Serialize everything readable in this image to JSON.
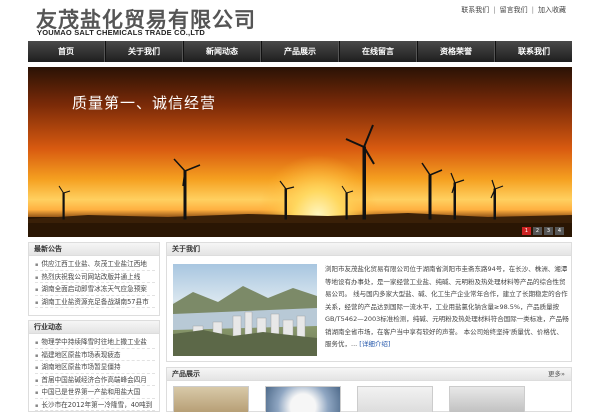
{
  "header": {
    "logo_cn": "友茂盐化贸易有限公司",
    "logo_en": "YOUMAO SALT CHEMICALS TRADE CO.,LTD",
    "links": [
      "联系我们",
      "留言我们",
      "加入收藏"
    ]
  },
  "nav": {
    "items": [
      "首页",
      "关于我们",
      "新闻动态",
      "产品展示",
      "在线留言",
      "资格荣誉",
      "联系我们"
    ]
  },
  "banner": {
    "title": "质量第一、诚信经营",
    "dots": [
      "1",
      "2",
      "3",
      "4"
    ],
    "active_dot": 0
  },
  "latest": {
    "title": "最新公告",
    "items": [
      "供应江西工业盐、灰茂工业盐江西地",
      "热烈庆祝我公司网站改版并通上线",
      "湖南全面启动即雪冰冻天气应急预案",
      "湖南工业盐资源充足备战湖南57县市"
    ]
  },
  "industry": {
    "title": "行业动态",
    "items": [
      "物理学中持续降雪时往地上撒工业盐",
      "福建地区原盐市场表现疲态",
      "湖南地区原盐市场暂显僵持",
      "首届中国盐碱经济合作高端峰会四月",
      "中国已是世界第一产盐和用盐大国",
      "长沙市在2012年第一冷隆雪，40吨到"
    ]
  },
  "about": {
    "title": "关于我们",
    "text": "浏阳市友茂盐化贸易有限公司位于湖南省浏阳市圭斋东路94号，在长沙、株洲、湘潭等地设有办事处，是一家经营工业盐、纯碱、元明粉及热处理材料等产品的综合性贸易公司。 线与国内多家大型盐、碱、化工生产企业常年合作，建立了长期稳定的合作关系，经营的产品达到国际一流水平，工业用盐氯化钠含量≥98.5%，产品质量按GB/T5462—2003标准检测，纯碱、元明粉及热处理材料符合国际一类标准，产品畅销湖南全省市场，在客户当中享有较好的声誉。 本公司始终坚持'质量优、价格优、服务优，...",
    "more": "[详细介绍]"
  },
  "products": {
    "title": "产品展示",
    "more": "更多»",
    "thumbs": [
      "sack-stack",
      "salt-dish",
      "salt-pile",
      "bags-pile",
      "white-powder"
    ]
  }
}
